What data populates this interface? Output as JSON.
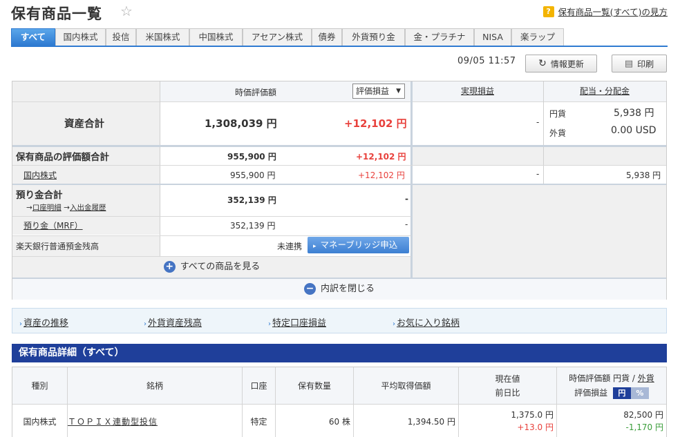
{
  "page": {
    "title": "保有商品一覧",
    "help_label": "保有商品一覧(すべて)の見方"
  },
  "tabs": [
    "すべて",
    "国内株式",
    "投信",
    "米国株式",
    "中国株式",
    "アセアン株式",
    "債券",
    "外貨預り金",
    "金・プラチナ",
    "NISA",
    "楽ラップ"
  ],
  "toolbar": {
    "datetime": "09/05 11:57",
    "refresh_label": "情報更新",
    "print_label": "印刷"
  },
  "summary": {
    "col_market_value": "時価評価額",
    "dropdown_value": "評価損益",
    "col_realized": "実現損益",
    "col_dividend": "配当・分配金",
    "total": {
      "label": "資産合計",
      "value": "1,308,039 円",
      "gain": "+12,102 円",
      "realized": "-",
      "yen_label": "円貨",
      "yen_value": "5,938 円",
      "fx_label": "外貨",
      "fx_value": "0.00 USD"
    },
    "holdings": {
      "label": "保有商品の評価額合計",
      "value": "955,900 円",
      "gain": "+12,102 円"
    },
    "domestic": {
      "label": "国内株式",
      "value": "955,900 円",
      "gain": "+12,102 円",
      "realized": "-",
      "dividend": "5,938 円"
    },
    "deposit": {
      "label": "預り金合計",
      "link1": "口座明細",
      "link2": "入出金履歴",
      "value": "352,139 円",
      "gain": "-"
    },
    "mrf": {
      "label": "預り金（MRF）",
      "value": "352,139 円",
      "gain": "-"
    },
    "bank": {
      "label": "楽天銀行普通預金残高",
      "status": "未連携",
      "button": "マネーブリッジ申込"
    },
    "show_all": "すべての商品を見る",
    "close_breakdown": "内訳を閉じる"
  },
  "links": [
    "資産の推移",
    "外貨資産残高",
    "特定口座損益",
    "お気に入り銘柄"
  ],
  "detail": {
    "title": "保有商品詳細（すべて）",
    "headers": {
      "type": "種別",
      "name": "銘柄",
      "account": "口座",
      "quantity": "保有数量",
      "avg_price": "平均取得価額",
      "current": "現在値",
      "change": "前日比",
      "market_value": "時価評価額",
      "yen": "円貨",
      "fx": "外貨",
      "gain": "評価損益",
      "seg_yen": "円",
      "seg_pct": "%"
    },
    "rows": [
      {
        "type": "国内株式",
        "name": "ＴＯＰＩＸ連動型投信",
        "account": "特定",
        "quantity": "60 株",
        "avg_price": "1,394.50 円",
        "current": "1,375.0 円",
        "change": "+13.0 円",
        "market_value": "82,500 円",
        "gain": "-1,170 円"
      }
    ]
  }
}
